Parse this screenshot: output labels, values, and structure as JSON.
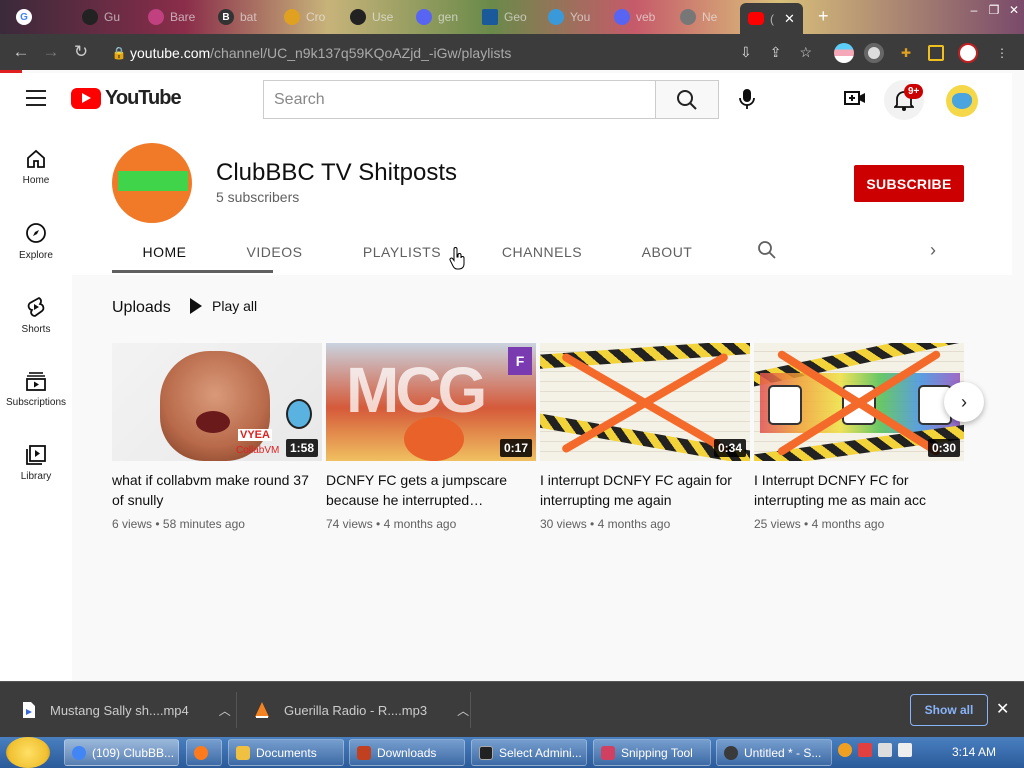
{
  "browser": {
    "tabs": [
      {
        "label": "",
        "icon": "google-icon",
        "color": "#4285f4"
      },
      {
        "label": "Gu",
        "icon": "site-icon",
        "color": "#222222"
      },
      {
        "label": "Bare",
        "icon": "site-icon",
        "color": "#c04080"
      },
      {
        "label": "bat",
        "icon": "b-icon",
        "color": "#333333"
      },
      {
        "label": "Cro",
        "icon": "site-icon",
        "color": "#e0a020"
      },
      {
        "label": "Use",
        "icon": "github-icon",
        "color": "#222222"
      },
      {
        "label": "gen",
        "icon": "discord-icon",
        "color": "#5865f2"
      },
      {
        "label": "Geo",
        "icon": "site-icon",
        "color": "#1a5a9a"
      },
      {
        "label": "You",
        "icon": "site-icon",
        "color": "#3a9ad9"
      },
      {
        "label": "veb",
        "icon": "discord-icon",
        "color": "#5865f2"
      },
      {
        "label": "Ne",
        "icon": "globe-icon",
        "color": "#777777"
      },
      {
        "label": "(",
        "icon": "youtube-icon",
        "color": "#ff0000"
      }
    ],
    "url_host": "youtube.com",
    "url_path": "/channel/UC_n9k137q59KQoAZjd_-iGw/playlists"
  },
  "youtube": {
    "logo_text": "YouTube",
    "search_placeholder": "Search",
    "notification_count": "9+",
    "sidebar": [
      {
        "label": "Home",
        "icon": "home-icon"
      },
      {
        "label": "Explore",
        "icon": "compass-icon"
      },
      {
        "label": "Shorts",
        "icon": "shorts-icon"
      },
      {
        "label": "Subscriptions",
        "icon": "subscriptions-icon"
      },
      {
        "label": "Library",
        "icon": "library-icon"
      }
    ]
  },
  "channel": {
    "name": "ClubBBC TV Shitposts",
    "subscribers": "5 subscribers",
    "subscribe_label": "SUBSCRIBE",
    "tabs": [
      "HOME",
      "VIDEOS",
      "PLAYLISTS",
      "CHANNELS",
      "ABOUT"
    ],
    "active_tab": "HOME",
    "section_title": "Uploads",
    "play_all_label": "Play all"
  },
  "videos": [
    {
      "title": "what if collabvm make round 37 of snully",
      "duration": "1:58",
      "views": "6 views",
      "age": "58 minutes ago",
      "thumb_text_1": "VYEA",
      "thumb_text_2": "CollabVM"
    },
    {
      "title": "DCNFY FC gets a jumpscare because he interrupted…",
      "duration": "0:17",
      "views": "74 views",
      "age": "4 months ago",
      "thumb_text_1": "MCG",
      "thumb_text_2": "F"
    },
    {
      "title": "I interrupt DCNFY FC again for interrupting me again",
      "duration": "0:34",
      "views": "30 views",
      "age": "4 months ago"
    },
    {
      "title": "I Interrupt DCNFY FC for interrupting me as main acc",
      "duration": "0:30",
      "views": "25 views",
      "age": "4 months ago"
    }
  ],
  "downloads": [
    {
      "name": "Mustang Sally sh....mp4",
      "icon": "file-icon"
    },
    {
      "name": "Guerilla Radio - R....mp3",
      "icon": "vlc-icon"
    }
  ],
  "download_bar": {
    "show_all": "Show all"
  },
  "taskbar": {
    "items": [
      {
        "label": "(109) ClubBB...",
        "color": "#4285f4"
      },
      {
        "label": "",
        "color": "#ff7a1a"
      },
      {
        "label": "Documents",
        "color": "#f0c040"
      },
      {
        "label": "Downloads",
        "color": "#c04020"
      },
      {
        "label": "Select Admini...",
        "color": "#222222"
      },
      {
        "label": "Snipping Tool",
        "color": "#d04060"
      },
      {
        "label": "Untitled * - S...",
        "color": "#3a3a3a"
      }
    ],
    "clock": "3:14 AM"
  }
}
